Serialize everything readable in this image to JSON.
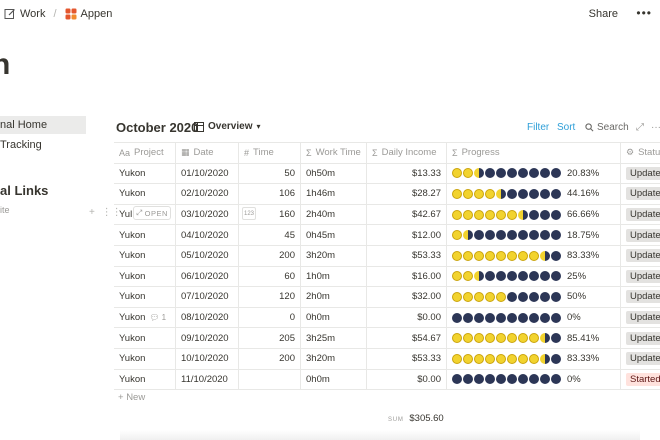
{
  "breadcrumb": {
    "item1": "Work",
    "sep": "/",
    "item2": "Appen"
  },
  "share_label": "Share",
  "page_title": "n",
  "sidebar": {
    "item1": "nal Home",
    "item2": "Tracking",
    "heading": "al Links",
    "sub": "ite"
  },
  "database": {
    "title": "October 2020",
    "view": "Overview",
    "filter": "Filter",
    "sort": "Sort",
    "search": "Search"
  },
  "columns": {
    "project": "Project",
    "date": "Date",
    "time": "Time",
    "work": "Work Time",
    "daily": "Daily Income",
    "progress": "Progress",
    "status": "Statu"
  },
  "rows": [
    {
      "project": "Yukon",
      "date": "01/10/2020",
      "time": "50",
      "work": "0h50m",
      "daily": "$13.33",
      "progress": 0.2083,
      "pct": "20.83%",
      "status": "Update",
      "status_color": "gray"
    },
    {
      "project": "Yukon",
      "date": "02/10/2020",
      "time": "106",
      "work": "1h46m",
      "daily": "$28.27",
      "progress": 0.4416,
      "pct": "44.16%",
      "status": "Update",
      "status_color": "gray"
    },
    {
      "project": "Yul",
      "date": "03/10/2020",
      "time": "160",
      "work": "2h40m",
      "daily": "$42.67",
      "progress": 0.6666,
      "pct": "66.66%",
      "status": "Update",
      "status_color": "gray"
    },
    {
      "project": "Yukon",
      "date": "04/10/2020",
      "time": "45",
      "work": "0h45m",
      "daily": "$12.00",
      "progress": 0.1875,
      "pct": "18.75%",
      "status": "Update",
      "status_color": "gray"
    },
    {
      "project": "Yukon",
      "date": "05/10/2020",
      "time": "200",
      "work": "3h20m",
      "daily": "$53.33",
      "progress": 0.8333,
      "pct": "83.33%",
      "status": "Update",
      "status_color": "gray"
    },
    {
      "project": "Yukon",
      "date": "06/10/2020",
      "time": "60",
      "work": "1h0m",
      "daily": "$16.00",
      "progress": 0.25,
      "pct": "25%",
      "status": "Update",
      "status_color": "gray"
    },
    {
      "project": "Yukon",
      "date": "07/10/2020",
      "time": "120",
      "work": "2h0m",
      "daily": "$32.00",
      "progress": 0.5,
      "pct": "50%",
      "status": "Update",
      "status_color": "gray"
    },
    {
      "project": "Yukon",
      "date": "08/10/2020",
      "time": "0",
      "work": "0h0m",
      "daily": "$0.00",
      "progress": 0,
      "pct": "0%",
      "status": "Update",
      "status_color": "gray"
    },
    {
      "project": "Yukon",
      "date": "09/10/2020",
      "time": "205",
      "work": "3h25m",
      "daily": "$54.67",
      "progress": 0.8541,
      "pct": "85.41%",
      "status": "Update",
      "status_color": "gray"
    },
    {
      "project": "Yukon",
      "date": "10/10/2020",
      "time": "200",
      "work": "3h20m",
      "daily": "$53.33",
      "progress": 0.8333,
      "pct": "83.33%",
      "status": "Update",
      "status_color": "gray"
    },
    {
      "project": "Yukon",
      "date": "11/10/2020",
      "time": "",
      "work": "0h0m",
      "daily": "$0.00",
      "progress": 0,
      "pct": "0%",
      "status": "Started",
      "status_color": "red"
    }
  ],
  "row_overlay": {
    "open": "OPEN",
    "comment_count": "1",
    "time_badge": "123"
  },
  "new_label": "New",
  "sum": {
    "label": "SUM",
    "value": "$305.60"
  }
}
